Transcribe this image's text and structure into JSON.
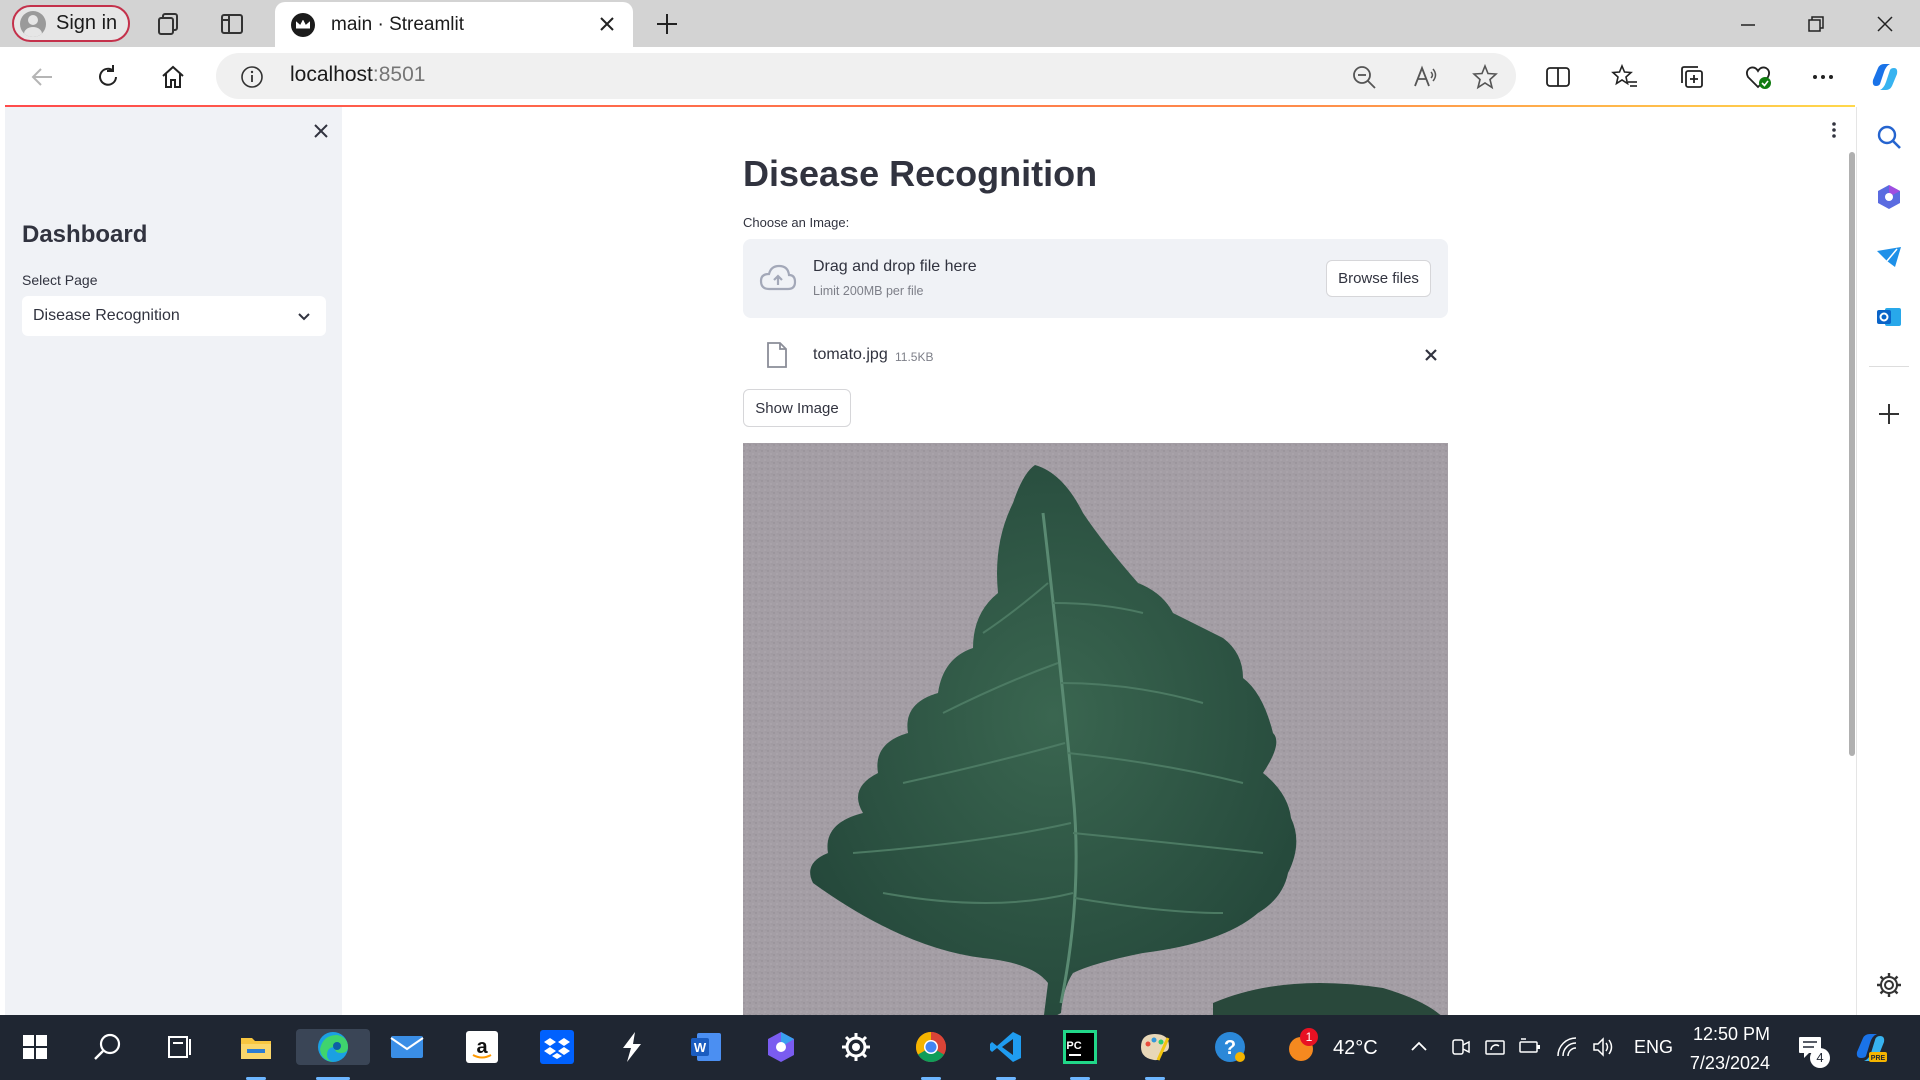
{
  "browser": {
    "signin_label": "Sign in",
    "tab_title": "main · Streamlit",
    "url_host": "localhost",
    "url_port": ":8501"
  },
  "sidebar": {
    "heading": "Dashboard",
    "select_label": "Select Page",
    "select_value": "Disease Recognition"
  },
  "main": {
    "title": "Disease Recognition",
    "uploader_label": "Choose an Image:",
    "dropzone_text": "Drag and drop file here",
    "dropzone_limit": "Limit 200MB per file",
    "browse_label": "Browse files",
    "file_name": "tomato.jpg",
    "file_size": "11.5KB",
    "show_image_label": "Show Image"
  },
  "taskbar": {
    "weather_temp": "42°C",
    "weather_badge": "1",
    "language": "ENG",
    "time": "12:50 PM",
    "date": "7/23/2024",
    "notification_count": "4"
  },
  "colors": {
    "streamlit_accent": "#ff4b4b",
    "sidebar_bg": "#f0f2f6",
    "taskbar_bg": "#1f2632",
    "leaf_green": "#2f5a45"
  }
}
